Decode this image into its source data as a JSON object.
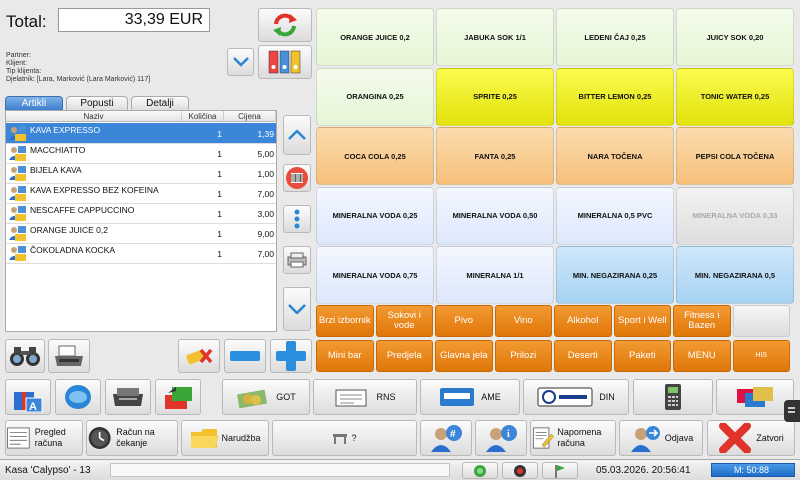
{
  "total": {
    "label": "Total:",
    "value": "33,39 EUR"
  },
  "info": {
    "partner": "Partner:",
    "klijent": "Klijent:",
    "tip": "Tip klijenta:",
    "djelatnik": "Djelatnik: [Lara, Marković (Lara Marković) 117]"
  },
  "tabs": [
    "Artikli",
    "Popusti",
    "Detalji"
  ],
  "table": {
    "headers": [
      "Naziv",
      "Količina",
      "Cijena"
    ],
    "rows": [
      {
        "name": "KAVA EXPRESSO",
        "qty": "1",
        "price": "1,39"
      },
      {
        "name": "MACCHIATTO",
        "qty": "1",
        "price": "5,00"
      },
      {
        "name": "BIJELA KAVA",
        "qty": "1",
        "price": "1,00"
      },
      {
        "name": "KAVA EXPRESSO BEZ KOFEINA",
        "qty": "1",
        "price": "7,00"
      },
      {
        "name": "NESCAFFE CAPPUCCINO",
        "qty": "1",
        "price": "3,00"
      },
      {
        "name": "ORANGE JUICE 0,2",
        "qty": "1",
        "price": "9,00"
      },
      {
        "name": "ČOKOLADNA KOCKA",
        "qty": "1",
        "price": "7,00"
      }
    ]
  },
  "products": [
    [
      "ORANGE JUICE 0,2",
      "JABUKA SOK 1/1",
      "LEDENI ČAJ 0,25",
      "JUICY SOK 0,20"
    ],
    [
      "ORANGINA 0,25",
      "SPRITE 0,25",
      "BITTER LEMON 0,25",
      "TONIC WATER 0,25"
    ],
    [
      "COCA COLA 0,25",
      "FANTA 0,25",
      "NARA TOČENA",
      "PEPSI COLA TOČENA"
    ],
    [
      "MINERALNA VODA 0,25",
      "MINERALNA VODA 0,50",
      "MINERALNA 0,5 PVC",
      "MINERALNA VODA 0,33"
    ],
    [
      "MINERALNA VODA 0,75",
      "MINERALNA 1/1",
      "MIN. NEGAZIRANA 0,25",
      "MIN. NEGAZIRANA 0,5"
    ]
  ],
  "product_colors": [
    [
      "green",
      "green",
      "green",
      "green"
    ],
    [
      "green",
      "yellow",
      "yellow",
      "yellow"
    ],
    [
      "orange",
      "orange",
      "orange",
      "orange"
    ],
    [
      "lightblue",
      "lightblue",
      "lightblue",
      "grey"
    ],
    [
      "lightblue",
      "lightblue",
      "cyan",
      "cyan"
    ]
  ],
  "categories_row1": [
    "Brzi izbornik",
    "Sokovi i vode",
    "Pivo",
    "Vino",
    "Alkohol",
    "Sport i Well",
    "Fitness i Bazen",
    ""
  ],
  "categories_row2": [
    "Mini bar",
    "Predjela",
    "Glavna jela",
    "Prilozi",
    "Deserti",
    "Paketi",
    "MENU",
    "HIS"
  ],
  "payments": {
    "got": "GOT",
    "rns": "RNS",
    "ame": "AME",
    "din": "DIN"
  },
  "bottom": {
    "pregled": "Pregled računa",
    "cekanje": "Račun na čekanje",
    "narudzba": "Narudžba",
    "question": "?",
    "napomena": "Napomena računa",
    "odjava": "Odjava",
    "zatvori": "Zatvori"
  },
  "status": {
    "kasa": "Kasa 'Calypso' - 13",
    "datetime": "05.03.2026. 20:56:41",
    "user": "M: 50:88"
  },
  "colors": {
    "accent": "#3b86d8",
    "orange": "#e07608",
    "red_x": "#e0342b"
  }
}
